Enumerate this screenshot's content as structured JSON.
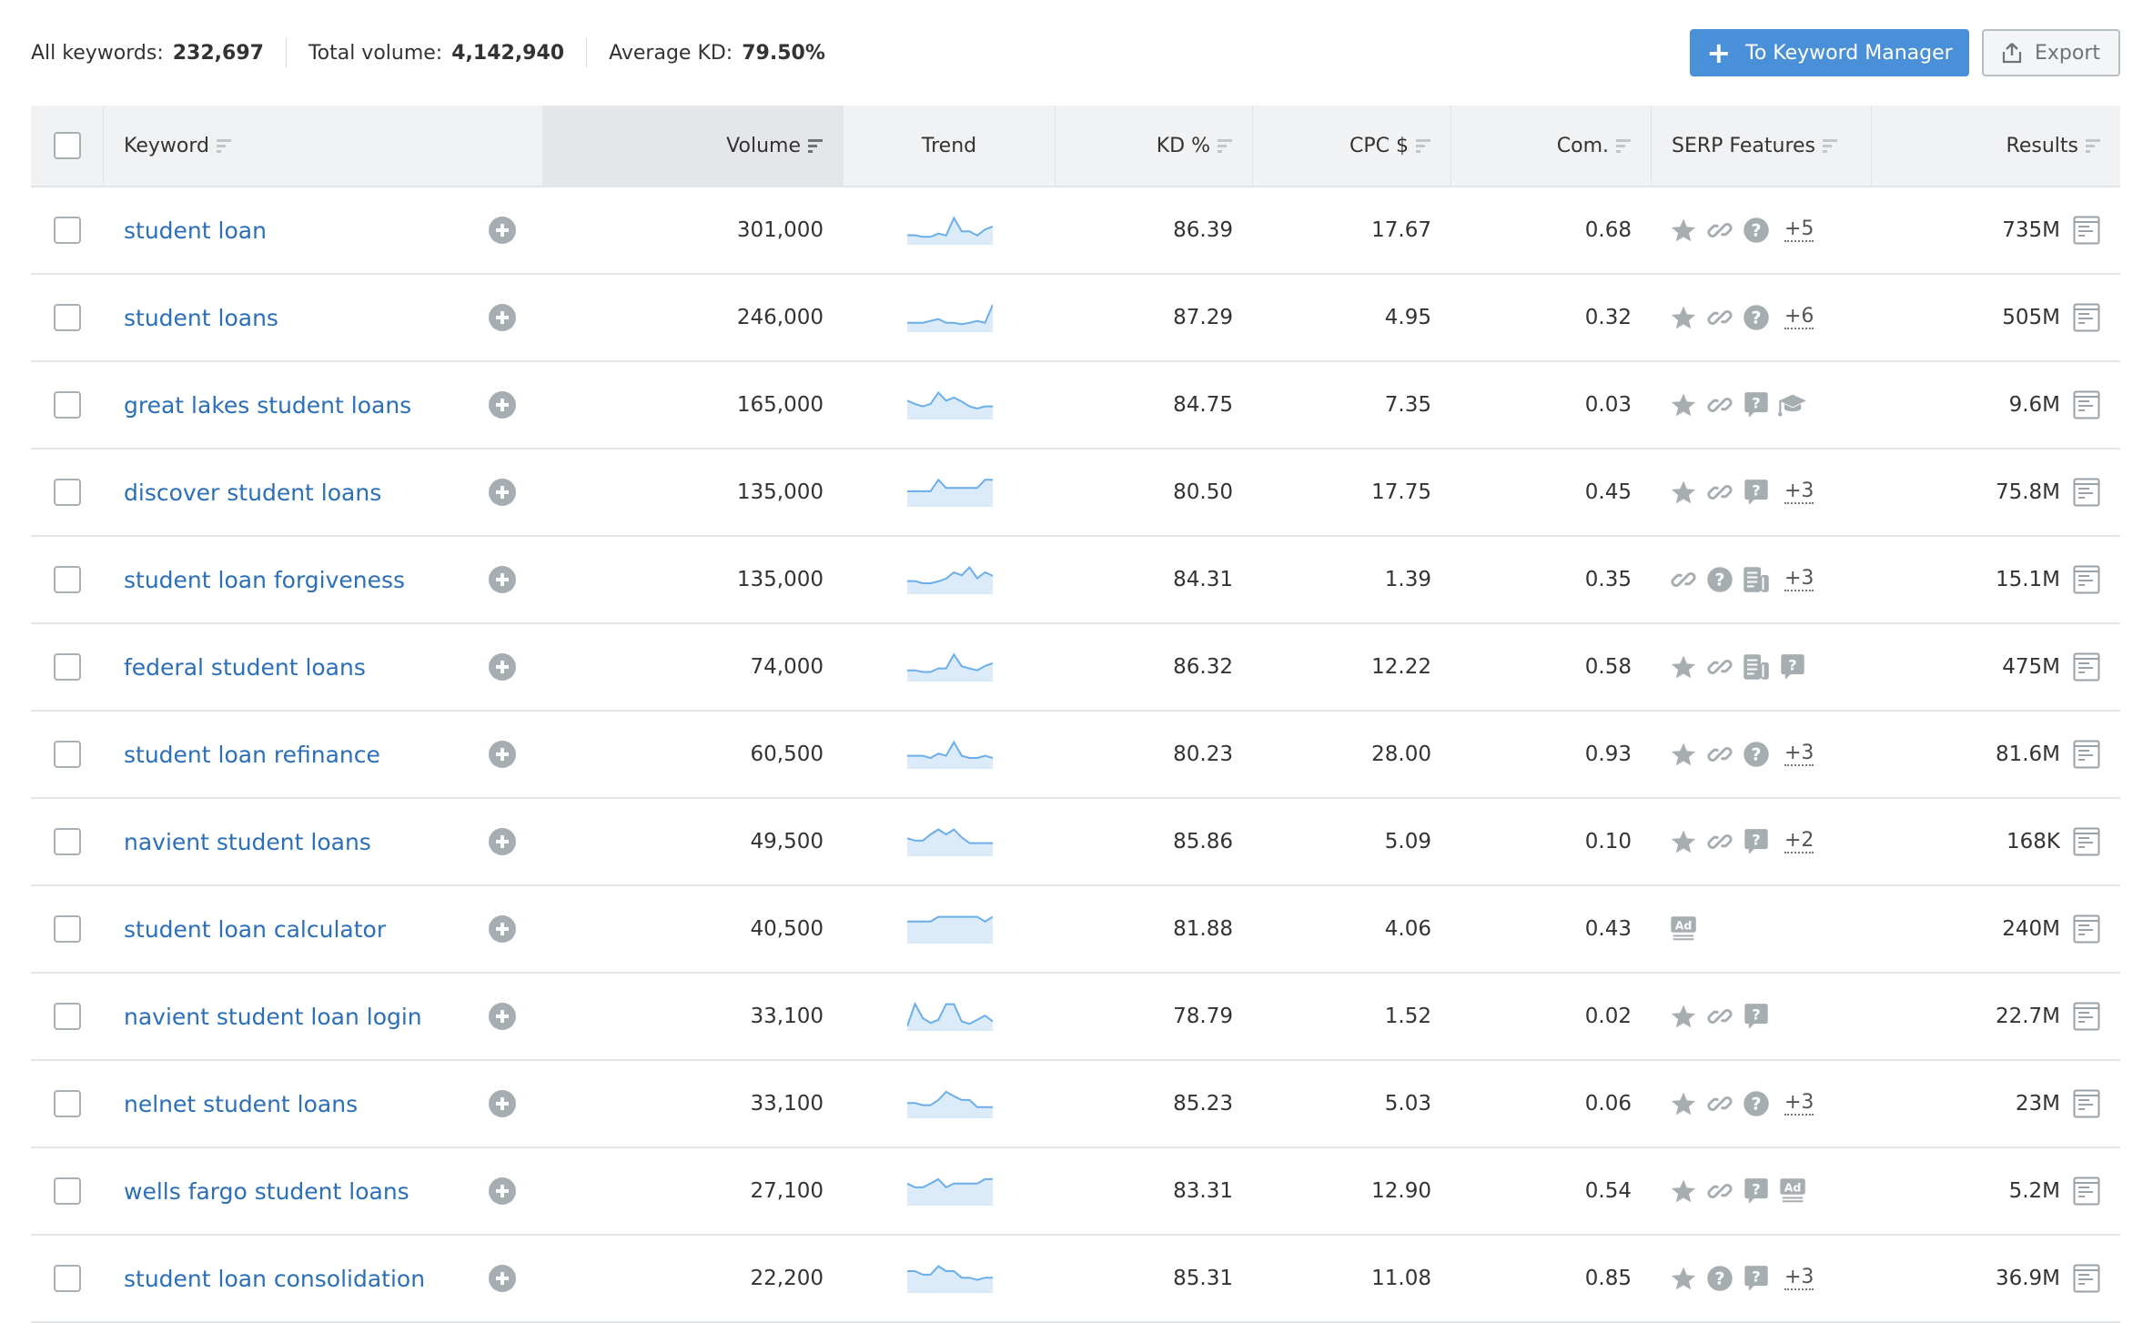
{
  "summary": {
    "all_keywords_label": "All keywords:",
    "all_keywords_value": "232,697",
    "total_volume_label": "Total volume:",
    "total_volume_value": "4,142,940",
    "average_kd_label": "Average KD:",
    "average_kd_value": "79.50%"
  },
  "toolbar": {
    "keyword_manager_label": "To Keyword Manager",
    "keyword_manager_icon": "plus-icon",
    "export_label": "Export",
    "export_icon": "export-icon",
    "accent_color": "#4a90d9"
  },
  "columns": {
    "keyword": "Keyword",
    "volume": "Volume",
    "trend": "Trend",
    "kd": "KD %",
    "cpc": "CPC $",
    "com": "Com.",
    "serp": "SERP Features",
    "results": "Results",
    "sorted_by": "Volume"
  },
  "rows": [
    {
      "keyword": "student loan",
      "volume": "301,000",
      "trend": [
        0.35,
        0.35,
        0.29,
        0.29,
        0.41,
        0.34,
        0.98,
        0.49,
        0.49,
        0.34,
        0.56,
        0.67
      ],
      "kd": "86.39",
      "cpc": "17.67",
      "com": "0.68",
      "serp": [
        "star-icon",
        "link-icon",
        "question-circle-icon"
      ],
      "serp_more": "+5",
      "results": "735M"
    },
    {
      "keyword": "student loans",
      "volume": "246,000",
      "trend": [
        0.34,
        0.34,
        0.34,
        0.41,
        0.48,
        0.34,
        0.34,
        0.29,
        0.34,
        0.41,
        0.34,
        1.0
      ],
      "kd": "87.29",
      "cpc": "4.95",
      "com": "0.32",
      "serp": [
        "star-icon",
        "link-icon",
        "question-circle-icon"
      ],
      "serp_more": "+6",
      "results": "505M"
    },
    {
      "keyword": "great lakes student loans",
      "volume": "165,000",
      "trend": [
        0.69,
        0.57,
        0.48,
        0.57,
        0.98,
        0.69,
        0.8,
        0.66,
        0.48,
        0.4,
        0.48,
        0.48
      ],
      "kd": "84.75",
      "cpc": "7.35",
      "com": "0.03",
      "serp": [
        "star-icon",
        "link-icon",
        "question-bubble-icon",
        "graduation-cap-icon"
      ],
      "serp_more": "",
      "results": "9.6M"
    },
    {
      "keyword": "discover student loans",
      "volume": "135,000",
      "trend": [
        0.57,
        0.57,
        0.57,
        0.57,
        0.99,
        0.69,
        0.69,
        0.69,
        0.69,
        0.69,
        0.99,
        0.99
      ],
      "kd": "80.50",
      "cpc": "17.75",
      "com": "0.45",
      "serp": [
        "star-icon",
        "link-icon",
        "question-bubble-icon"
      ],
      "serp_more": "+3",
      "results": "75.8M"
    },
    {
      "keyword": "student loan forgiveness",
      "volume": "135,000",
      "trend": [
        0.48,
        0.48,
        0.4,
        0.4,
        0.47,
        0.57,
        0.8,
        0.69,
        0.98,
        0.58,
        0.8,
        0.67
      ],
      "kd": "84.31",
      "cpc": "1.39",
      "com": "0.35",
      "serp": [
        "link-icon",
        "question-circle-icon",
        "news-icon"
      ],
      "serp_more": "+3",
      "results": "15.1M"
    },
    {
      "keyword": "federal student loans",
      "volume": "74,000",
      "trend": [
        0.41,
        0.41,
        0.35,
        0.35,
        0.48,
        0.48,
        0.99,
        0.56,
        0.48,
        0.41,
        0.57,
        0.67
      ],
      "kd": "86.32",
      "cpc": "12.22",
      "com": "0.58",
      "serp": [
        "star-icon",
        "link-icon",
        "news-icon",
        "question-bubble-icon"
      ],
      "serp_more": "",
      "results": "475M"
    },
    {
      "keyword": "student loan refinance",
      "volume": "60,500",
      "trend": [
        0.48,
        0.48,
        0.48,
        0.4,
        0.56,
        0.48,
        0.98,
        0.48,
        0.4,
        0.4,
        0.48,
        0.4
      ],
      "kd": "80.23",
      "cpc": "28.00",
      "com": "0.93",
      "serp": [
        "star-icon",
        "link-icon",
        "question-circle-icon"
      ],
      "serp_more": "+3",
      "results": "81.6M"
    },
    {
      "keyword": "navient student loans",
      "volume": "49,500",
      "trend": [
        0.66,
        0.57,
        0.57,
        0.8,
        0.98,
        0.8,
        0.98,
        0.69,
        0.48,
        0.48,
        0.48,
        0.48
      ],
      "kd": "85.86",
      "cpc": "5.09",
      "com": "0.10",
      "serp": [
        "star-icon",
        "link-icon",
        "question-bubble-icon"
      ],
      "serp_more": "+2",
      "results": "168K"
    },
    {
      "keyword": "student loan calculator",
      "volume": "40,500",
      "trend": [
        0.81,
        0.81,
        0.81,
        0.81,
        0.98,
        0.98,
        0.98,
        0.98,
        0.98,
        0.98,
        0.81,
        0.98
      ],
      "kd": "81.88",
      "cpc": "4.06",
      "com": "0.43",
      "serp": [
        "ad-icon"
      ],
      "serp_more": "",
      "results": "240M"
    },
    {
      "keyword": "navient student loan login",
      "volume": "33,100",
      "trend": [
        0.17,
        0.99,
        0.47,
        0.29,
        0.41,
        0.98,
        0.98,
        0.35,
        0.26,
        0.41,
        0.56,
        0.35
      ],
      "kd": "78.79",
      "cpc": "1.52",
      "com": "0.02",
      "serp": [
        "star-icon",
        "link-icon",
        "question-bubble-icon"
      ],
      "serp_more": "",
      "results": "22.7M"
    },
    {
      "keyword": "nelnet student loans",
      "volume": "33,100",
      "trend": [
        0.56,
        0.56,
        0.48,
        0.48,
        0.67,
        0.97,
        0.81,
        0.67,
        0.67,
        0.41,
        0.41,
        0.41
      ],
      "kd": "85.23",
      "cpc": "5.03",
      "com": "0.06",
      "serp": [
        "star-icon",
        "link-icon",
        "question-circle-icon"
      ],
      "serp_more": "+3",
      "results": "23M"
    },
    {
      "keyword": "wells fargo student loans",
      "volume": "27,100",
      "trend": [
        0.81,
        0.67,
        0.67,
        0.81,
        0.97,
        0.67,
        0.81,
        0.81,
        0.81,
        0.81,
        0.97,
        0.97
      ],
      "kd": "83.31",
      "cpc": "12.90",
      "com": "0.54",
      "serp": [
        "star-icon",
        "link-icon",
        "question-bubble-icon",
        "ad-icon"
      ],
      "serp_more": "",
      "results": "5.2M"
    },
    {
      "keyword": "student loan consolidation",
      "volume": "22,200",
      "trend": [
        0.8,
        0.8,
        0.67,
        0.67,
        0.98,
        0.8,
        0.8,
        0.56,
        0.56,
        0.48,
        0.56,
        0.56
      ],
      "kd": "85.31",
      "cpc": "11.08",
      "com": "0.85",
      "serp": [
        "star-icon",
        "question-circle-icon",
        "question-bubble-icon"
      ],
      "serp_more": "+3",
      "results": "36.9M"
    }
  ],
  "colors": {
    "link": "#2a6fb8",
    "sparkline_line": "#6aaeea",
    "sparkline_fill": "#dcebfa",
    "icon_gray": "#a7aeb2"
  }
}
